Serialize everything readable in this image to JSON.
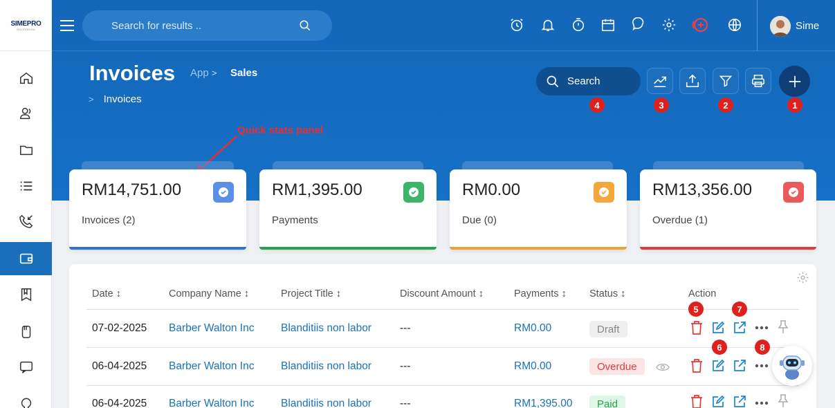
{
  "app": {
    "logo_text": "SIMEPRO",
    "logo_sub": "SOLUTIONS INC"
  },
  "header": {
    "search_placeholder": "Search for results ..",
    "user_name": "Sime",
    "top_icons": [
      "alarm-icon",
      "bell-icon",
      "timer-icon",
      "calendar-icon",
      "chat-icon",
      "gear-icon",
      "add-circle-icon",
      "globe-icon"
    ]
  },
  "page": {
    "title": "Invoices",
    "breadcrumb": [
      "App",
      "Sales",
      "Invoices"
    ],
    "search_label": "Search",
    "annotation": "Quick stats panel",
    "markers": [
      "1",
      "2",
      "3",
      "4",
      "5",
      "6",
      "7",
      "8"
    ]
  },
  "sidebar": {
    "items": [
      "home-icon",
      "contacts-icon",
      "folder-icon",
      "list-icon",
      "phone-icon",
      "wallet-icon",
      "book-icon",
      "files-icon",
      "chat-icon",
      "support-icon"
    ],
    "active_index": 5
  },
  "cards": [
    {
      "amount": "RM14,751.00",
      "label": "Invoices (2)",
      "color": "#5b8fe6",
      "bar": "#2f72d9"
    },
    {
      "amount": "RM1,395.00",
      "label": "Payments",
      "color": "#3cb46a",
      "bar": "#25a24c"
    },
    {
      "amount": "RM0.00",
      "label": "Due (0)",
      "color": "#f2a83a",
      "bar": "#f0a031"
    },
    {
      "amount": "RM13,356.00",
      "label": "Overdue (1)",
      "color": "#eb5a5a",
      "bar": "#e33b3b"
    }
  ],
  "table": {
    "columns": [
      "Date ↕",
      "Company Name ↕",
      "Project Title ↕",
      "Discount Amount ↕",
      "Payments ↕",
      "Status ↕",
      "Action"
    ],
    "rows": [
      {
        "date": "07-02-2025",
        "company": "Barber Walton Inc",
        "project": "Blanditiis non labor",
        "discount": "---",
        "payments": "RM0.00",
        "status": "Draft"
      },
      {
        "date": "06-04-2025",
        "company": "Barber Walton Inc",
        "project": "Blanditiis non labor",
        "discount": "---",
        "payments": "RM0.00",
        "status": "Overdue"
      },
      {
        "date": "06-04-2025",
        "company": "Barber Walton Inc",
        "project": "Blanditiis non labor",
        "discount": "---",
        "payments": "RM1,395.00",
        "status": "Paid"
      }
    ]
  }
}
